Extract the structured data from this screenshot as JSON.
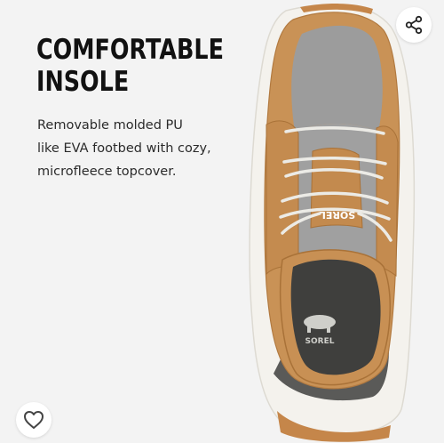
{
  "headline": {
    "line1": "COMFORTABLE",
    "line2": "INSOLE"
  },
  "description": {
    "line1": "Removable molded PU",
    "line2": "like EVA footbed with cozy,",
    "line3": "microfleece topcover."
  },
  "product_image": {
    "tongue_brand": "SOREL",
    "insole_brand": "SOREL"
  },
  "actions": {
    "share_icon": "share-icon",
    "favorite_icon": "heart-outline-icon"
  },
  "colors": {
    "background": "#f3f3f3",
    "text": "#111111",
    "leather": "#c99256",
    "felt": "#9a9a9a",
    "sole": "#f1efe9",
    "gum": "#c0803f"
  }
}
